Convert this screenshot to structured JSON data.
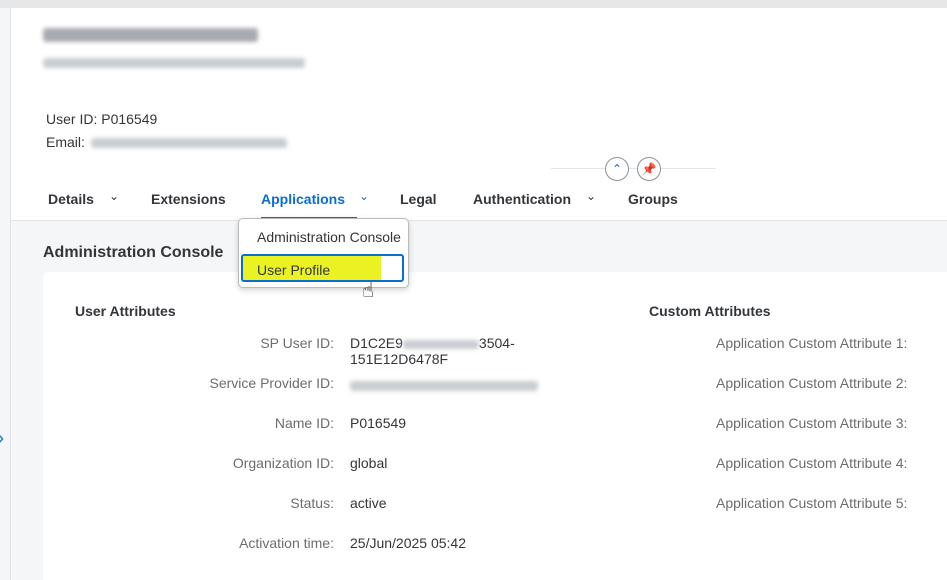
{
  "header": {
    "user_id_label": "User ID:",
    "user_id_value": "P016549",
    "email_label": "Email:"
  },
  "tabs": [
    {
      "label": "Details",
      "has_dropdown": true
    },
    {
      "label": "Extensions",
      "has_dropdown": false
    },
    {
      "label": "Applications",
      "has_dropdown": true,
      "active": true
    },
    {
      "label": "Legal",
      "has_dropdown": false
    },
    {
      "label": "Authentication",
      "has_dropdown": true
    },
    {
      "label": "Groups",
      "has_dropdown": false
    }
  ],
  "icons": {
    "collapse": "chevron-up-icon",
    "pin": "pin-icon",
    "dropdown": "chevron-down-icon",
    "cursor": "hand-pointer-icon",
    "left_nav": "chevron-right-icon"
  },
  "dropdown_menu": {
    "items": [
      "Administration Console",
      "User Profile"
    ],
    "highlighted": "User Profile"
  },
  "section": {
    "title": "Administration Console"
  },
  "user_attributes": {
    "title": "User Attributes",
    "rows": [
      {
        "label": "SP User ID:",
        "value_line1": "D1C2E9",
        "value_line1_end": "3504-",
        "value_line2": "151E12D6478F"
      },
      {
        "label": "Service Provider ID:",
        "value": ""
      },
      {
        "label": "Name ID:",
        "value": "P016549"
      },
      {
        "label": "Organization ID:",
        "value": "global"
      },
      {
        "label": "Status:",
        "value": "active"
      },
      {
        "label": "Activation time:",
        "value": "25/Jun/2025 05:42"
      }
    ]
  },
  "custom_attributes": {
    "title": "Custom Attributes",
    "labels": [
      "Application Custom Attribute 1:",
      "Application Custom Attribute 2:",
      "Application Custom Attribute 3:",
      "Application Custom Attribute 4:",
      "Application Custom Attribute 5:"
    ]
  },
  "colors": {
    "accent": "#0a6ed1",
    "highlight": "#eaf224"
  }
}
